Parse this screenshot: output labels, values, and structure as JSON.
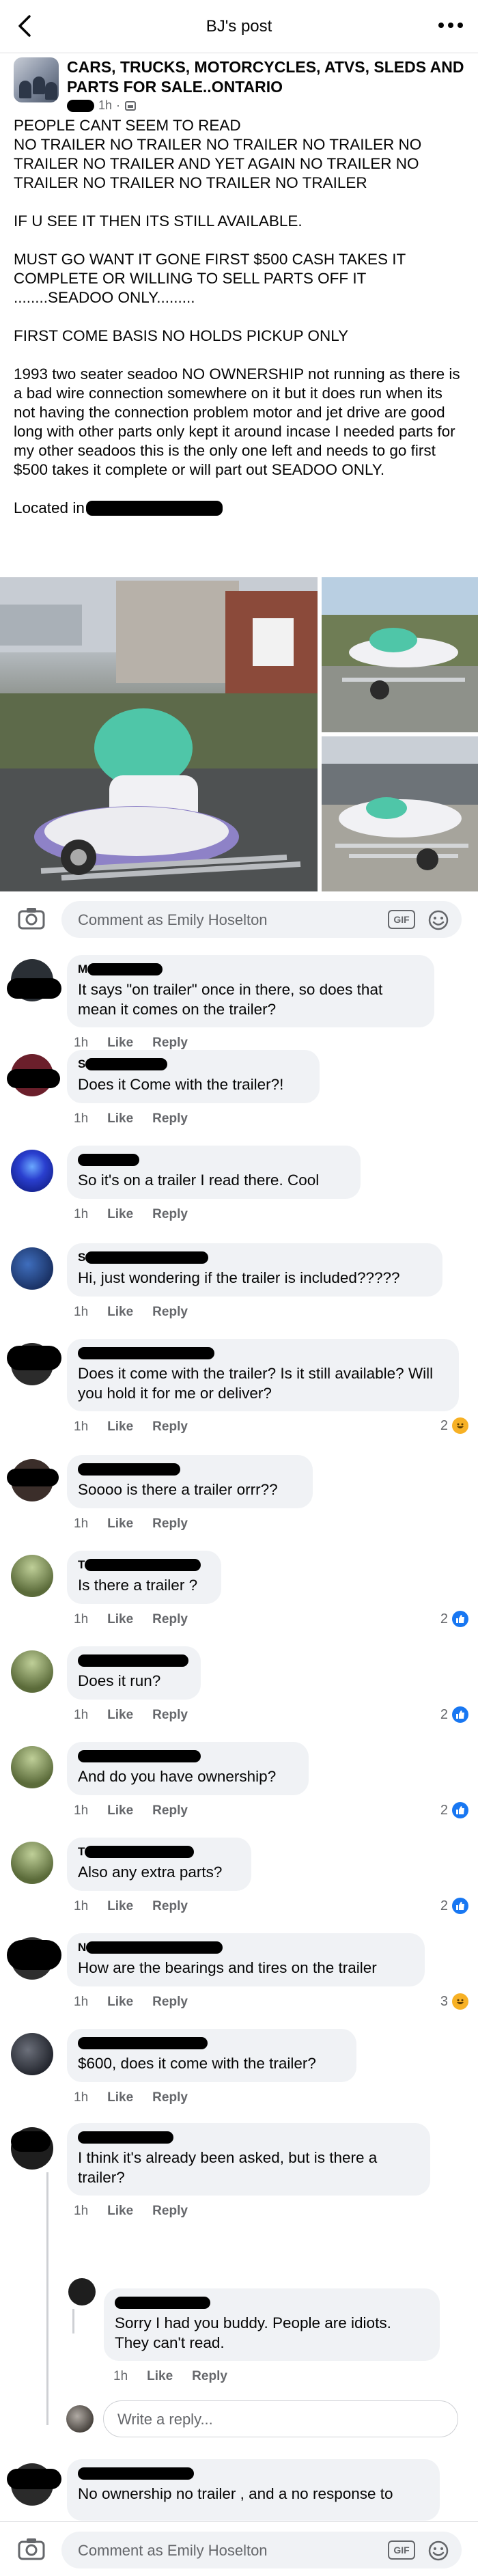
{
  "header": {
    "title": "BJ's post"
  },
  "post": {
    "group_name": "CARS, TRUCKS, MOTORCYCLES, ATVS, SLEDS AND  PARTS FOR SALE..ONTARIO",
    "time": "1h",
    "paragraphs": [
      "PEOPLE CANT SEEM TO READ\nNO TRAILER NO TRAILER NO TRAILER NO TRAILER NO TRAILER NO TRAILER AND YET AGAIN NO TRAILER NO TRAILER NO TRAILER NO TRAILER NO TRAILER",
      "IF U SEE IT THEN ITS STILL AVAILABLE.",
      "MUST GO WANT IT GONE  FIRST $500 CASH TAKES IT COMPLETE OR WILLING TO SELL PARTS OFF IT ........SEADOO ONLY.........",
      "FIRST COME BASIS NO HOLDS PICKUP ONLY",
      " 1993 two seater seadoo NO OWNERSHIP not running as there is a bad wire connection somewhere on it but it does run when its not having the connection problem motor and jet drive are good long with other parts only kept it around incase I needed parts for my other seadoos this is the only one left and needs to go first $500 takes it complete or will part out SEADOO ONLY."
    ],
    "located_label": "Located in"
  },
  "composer": {
    "placeholder": "Comment as Emily Hoselton",
    "gif": "GIF"
  },
  "reply_composer": {
    "placeholder": "Write a reply..."
  },
  "actions": {
    "like": "Like",
    "reply": "Reply"
  },
  "comments": [
    {
      "initial": "M",
      "text": "It says \"on trailer\" once in there, so does that mean it comes on the trailer?",
      "time": "1h",
      "reactions": ""
    },
    {
      "initial": "S",
      "text": "Does it Come with the trailer?!",
      "time": "1h",
      "reactions": ""
    },
    {
      "initial": "",
      "text": "So it's on a trailer I read there. Cool",
      "time": "1h",
      "reactions": ""
    },
    {
      "initial": "S",
      "text": "Hi, just wondering if the trailer is included?????",
      "time": "1h",
      "reactions": ""
    },
    {
      "initial": "",
      "text": "Does it come with the trailer? Is it still available? Will you hold it for me or deliver?",
      "time": "1h",
      "reactions": "2"
    },
    {
      "initial": "",
      "text": "Soooo is there a trailer orrr??",
      "time": "1h",
      "reactions": ""
    },
    {
      "initial": "T",
      "text": "Is there a trailer ?",
      "time": "1h",
      "reactions": "2"
    },
    {
      "initial": "",
      "text": "Does it run?",
      "time": "1h",
      "reactions": "2"
    },
    {
      "initial": "",
      "text": "And do you have ownership?",
      "time": "1h",
      "reactions": "2"
    },
    {
      "initial": "T",
      "text": "Also any extra parts?",
      "time": "1h",
      "reactions": "2"
    },
    {
      "initial": "N",
      "text": "How are the bearings and tires on the trailer",
      "time": "1h",
      "reactions": "3"
    },
    {
      "initial": "",
      "text": "$600, does it come with the trailer?",
      "time": "1h",
      "reactions": ""
    },
    {
      "initial": "",
      "text": "I think it's already been asked, but is there a trailer?",
      "time": "1h",
      "reactions": ""
    },
    {
      "initial": "",
      "text": "Sorry I had you buddy. People are idiots. They can't read.",
      "time": "1h",
      "reactions": ""
    },
    {
      "initial": "",
      "text": "No ownership no trailer , and a no response to",
      "time": "",
      "reactions": ""
    }
  ],
  "colors": {
    "like_blue": "#1877f2",
    "haha_yellow": "#f7b125",
    "bubble": "#f0f2f5",
    "meta_gray": "#65676b"
  }
}
